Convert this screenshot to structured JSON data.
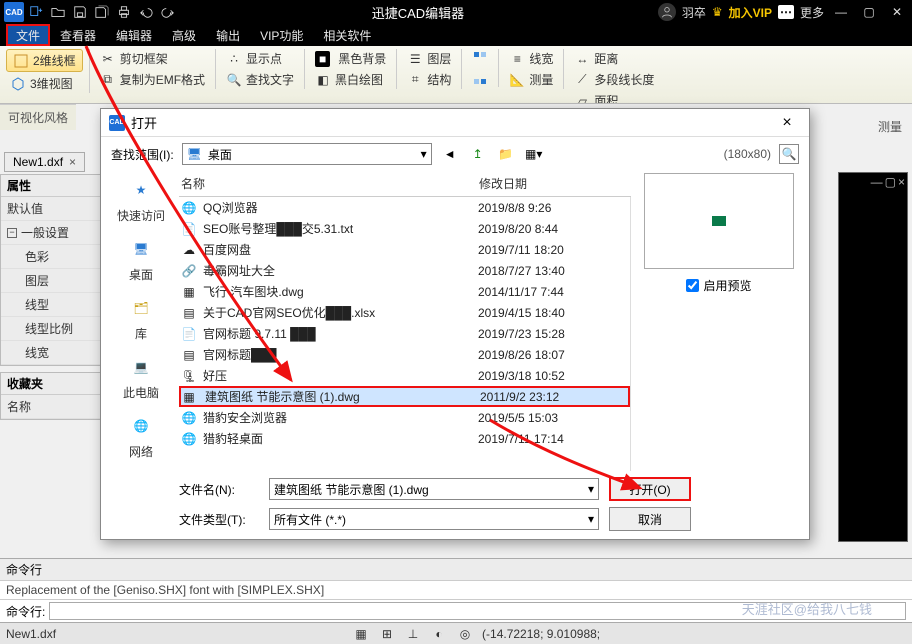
{
  "title": "迅捷CAD编辑器",
  "titlebar": {
    "user": "羽卒",
    "vip": "加入VIP",
    "more": "更多"
  },
  "menus": [
    "文件",
    "查看器",
    "编辑器",
    "高级",
    "输出",
    "VIP功能",
    "相关软件"
  ],
  "ribbon": {
    "wire2d": "2维线框",
    "view3d": "3维视图",
    "cutframe": "剪切框架",
    "copyemf": "复制为EMF格式",
    "showpts": "显示点",
    "findtext": "查找文字",
    "blackbg": "黑色背景",
    "bwdraw": "黑白绘图",
    "layers": "图层",
    "struct": "结构",
    "linew": "线宽",
    "measure": "测量",
    "dist": "距离",
    "polylen": "多段线长度",
    "area": "面积",
    "measure_grp": "测量",
    "visual_style": "可视化风格"
  },
  "doc_tab": "New1.dxf",
  "panels": {
    "props": "属性",
    "default": "默认值",
    "general": "一般设置",
    "rows": [
      "色彩",
      "图层",
      "线型",
      "线型比例",
      "线宽"
    ],
    "fav": "收藏夹",
    "name": "名称"
  },
  "dialog": {
    "title": "打开",
    "lookin_label": "查找范围(I):",
    "lookin_value": "桌面",
    "preview_dim": "(180x80)",
    "enable_preview": "启用预览",
    "col_name": "名称",
    "col_date": "修改日期",
    "places": [
      "快速访问",
      "桌面",
      "库",
      "此电脑",
      "网络"
    ],
    "files": [
      {
        "n": "QQ浏览器",
        "d": "2019/8/8 9:26",
        "ic": "globe"
      },
      {
        "n": "SEO账号整理███交5.31.txt",
        "d": "2019/8/20 8:44",
        "ic": "txt"
      },
      {
        "n": "百度网盘",
        "d": "2019/7/11 18:20",
        "ic": "cloud"
      },
      {
        "n": "毒霸网址大全",
        "d": "2018/7/27 13:40",
        "ic": "link"
      },
      {
        "n": "飞行 汽车图块.dwg",
        "d": "2014/11/17 7:44",
        "ic": "cad"
      },
      {
        "n": "关于CAD官网SEO优化███.xlsx",
        "d": "2019/4/15 18:40",
        "ic": "xls"
      },
      {
        "n": "官网标题 9.7.11 ███",
        "d": "2019/7/23 15:28",
        "ic": "txt"
      },
      {
        "n": "官网标题███",
        "d": "2019/8/26 18:07",
        "ic": "xls"
      },
      {
        "n": "好压",
        "d": "2019/3/18 10:52",
        "ic": "zip"
      },
      {
        "n": "建筑图纸 节能示意图 (1).dwg",
        "d": "2011/9/2 23:12",
        "ic": "cad",
        "sel": true
      },
      {
        "n": "猎豹安全浏览器",
        "d": "2019/5/5 15:03",
        "ic": "globe"
      },
      {
        "n": "猎豹轻桌面",
        "d": "2019/7/11 17:14",
        "ic": "globe"
      }
    ],
    "filename_label": "文件名(N):",
    "filename_value": "建筑图纸 节能示意图 (1).dwg",
    "filetype_label": "文件类型(T):",
    "filetype_value": "所有文件 (*.*)",
    "open_btn": "打开(O)",
    "cancel_btn": "取消"
  },
  "cmd": {
    "head": "命令行",
    "log": "Replacement of the [Geniso.SHX] font with [SIMPLEX.SHX]",
    "prompt": "命令行:"
  },
  "status": {
    "file": "New1.dxf",
    "coords": "(-14.72218; 9.010988; "
  },
  "watermark": "天涯社区@给我八七钱"
}
